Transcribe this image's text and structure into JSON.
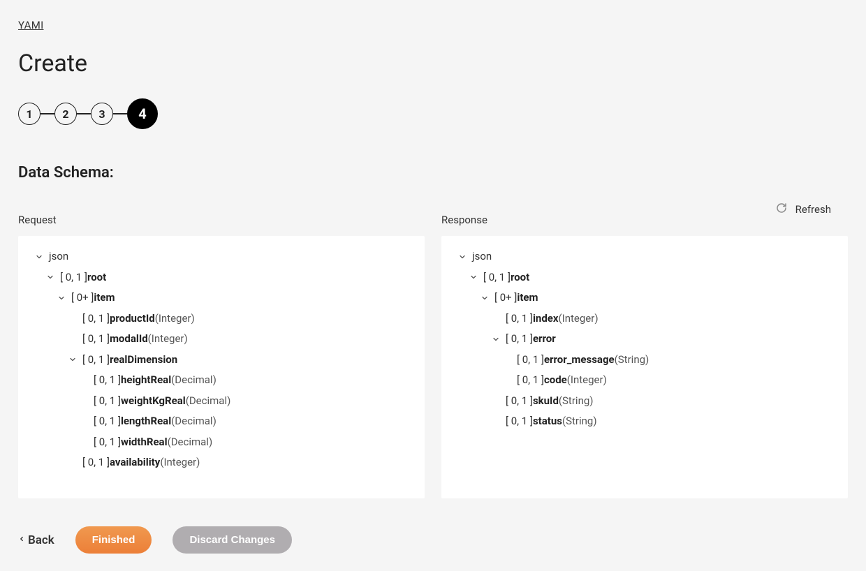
{
  "breadcrumb": "YAMI",
  "page_title": "Create",
  "stepper": {
    "steps": [
      "1",
      "2",
      "3",
      "4"
    ],
    "active_index": 3
  },
  "section_header": "Data Schema:",
  "refresh_label": "Refresh",
  "request_label": "Request",
  "response_label": "Response",
  "request_tree": [
    {
      "indent": 0,
      "chevron": true,
      "card": "",
      "name": "json",
      "type": "",
      "bold": false
    },
    {
      "indent": 1,
      "chevron": true,
      "card": "[ 0, 1 ]",
      "name": "root",
      "type": "",
      "bold": true
    },
    {
      "indent": 2,
      "chevron": true,
      "card": "[ 0+ ]",
      "name": "item",
      "type": "",
      "bold": true
    },
    {
      "indent": 3,
      "chevron": false,
      "card": "[ 0, 1 ]",
      "name": "productId",
      "type": "(Integer)",
      "bold": true
    },
    {
      "indent": 3,
      "chevron": false,
      "card": "[ 0, 1 ]",
      "name": "modalId",
      "type": "(Integer)",
      "bold": true
    },
    {
      "indent": 3,
      "chevron": true,
      "card": "[ 0, 1 ]",
      "name": "realDimension",
      "type": "",
      "bold": true
    },
    {
      "indent": 4,
      "chevron": false,
      "card": "[ 0, 1 ]",
      "name": "heightReal",
      "type": "(Decimal)",
      "bold": true
    },
    {
      "indent": 4,
      "chevron": false,
      "card": "[ 0, 1 ]",
      "name": "weightKgReal",
      "type": "(Decimal)",
      "bold": true
    },
    {
      "indent": 4,
      "chevron": false,
      "card": "[ 0, 1 ]",
      "name": "lengthReal",
      "type": "(Decimal)",
      "bold": true
    },
    {
      "indent": 4,
      "chevron": false,
      "card": "[ 0, 1 ]",
      "name": "widthReal",
      "type": "(Decimal)",
      "bold": true
    },
    {
      "indent": 3,
      "chevron": false,
      "card": "[ 0, 1 ]",
      "name": "availability",
      "type": "(Integer)",
      "bold": true
    }
  ],
  "response_tree": [
    {
      "indent": 0,
      "chevron": true,
      "card": "",
      "name": "json",
      "type": "",
      "bold": false
    },
    {
      "indent": 1,
      "chevron": true,
      "card": "[ 0, 1 ]",
      "name": "root",
      "type": "",
      "bold": true
    },
    {
      "indent": 2,
      "chevron": true,
      "card": "[ 0+ ]",
      "name": "item",
      "type": "",
      "bold": true
    },
    {
      "indent": 3,
      "chevron": false,
      "card": "[ 0, 1 ]",
      "name": "index",
      "type": "(Integer)",
      "bold": true
    },
    {
      "indent": 3,
      "chevron": true,
      "card": "[ 0, 1 ]",
      "name": "error",
      "type": "",
      "bold": true
    },
    {
      "indent": 4,
      "chevron": false,
      "card": "[ 0, 1 ]",
      "name": "error_message",
      "type": "(String)",
      "bold": true
    },
    {
      "indent": 4,
      "chevron": false,
      "card": "[ 0, 1 ]",
      "name": "code",
      "type": "(Integer)",
      "bold": true
    },
    {
      "indent": 3,
      "chevron": false,
      "card": "[ 0, 1 ]",
      "name": "skuId",
      "type": "(String)",
      "bold": true
    },
    {
      "indent": 3,
      "chevron": false,
      "card": "[ 0, 1 ]",
      "name": "status",
      "type": "(String)",
      "bold": true
    }
  ],
  "footer": {
    "back_label": "Back",
    "finished_label": "Finished",
    "discard_label": "Discard Changes"
  }
}
